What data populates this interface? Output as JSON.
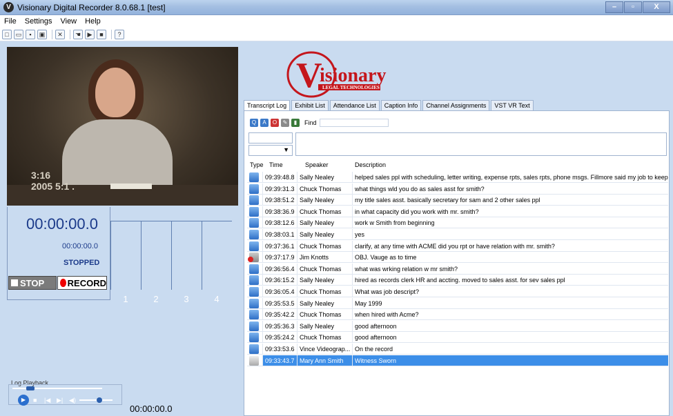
{
  "window": {
    "title": "Visionary Digital Recorder 8.0.68.1 [test]",
    "app_icon": "V"
  },
  "window_controls": [
    "–",
    "▫",
    "X"
  ],
  "menu": [
    "File",
    "Settings",
    "View",
    "Help"
  ],
  "toolbar_icons": [
    "new-file-icon",
    "open-file-icon",
    "save-icon",
    "save-as-icon",
    "tools-icon",
    "hand-icon",
    "camera-icon",
    "monitor-icon",
    "help-icon"
  ],
  "video": {
    "timestamp_line1": "3:16",
    "timestamp_line2": "2005 5:1 ."
  },
  "recorder": {
    "big_time": "00:00:00.0",
    "small_time": "00:00:00.0",
    "status": "STOPPED",
    "stop_label": "STOP",
    "record_label": "RECORD",
    "channels": [
      "1",
      "2",
      "3",
      "4"
    ]
  },
  "playback": {
    "label": "Log Playback",
    "time": "00:00:00.0",
    "position": 0.15,
    "volume": 0.5
  },
  "logo": {
    "name": "isionary",
    "initial": "V",
    "subtitle": "LEGAL TECHNOLOGIES",
    "color": "#c4161c"
  },
  "tabs": [
    "Transcript Log",
    "Exhibit List",
    "Attendance List",
    "Caption Info",
    "Channel Assignments",
    "VST VR Text"
  ],
  "active_tab": "Transcript Log",
  "log_toolbar": {
    "find_label": "Find"
  },
  "columns": [
    "Type",
    "Time",
    "Speaker",
    "Description"
  ],
  "rows": [
    {
      "type": "A",
      "time": "09:39:48.8",
      "speaker": "Sally Nealey",
      "desc": "helped sales ppl with scheduling, letter writing, expense rpts, sales rpts, phone msgs.  Fillmore said my job to keep them selling"
    },
    {
      "type": "Q",
      "time": "09:39:31.3",
      "speaker": "Chuck Thomas",
      "desc": "what things wld you do as sales asst for smith?"
    },
    {
      "type": "A",
      "time": "09:38:51.2",
      "speaker": "Sally Nealey",
      "desc": "my title sales asst.  basically secretary for sam and 2 other sales ppl"
    },
    {
      "type": "Q",
      "time": "09:38:36.9",
      "speaker": "Chuck Thomas",
      "desc": "in what capacity did you work with mr. smith?"
    },
    {
      "type": "A",
      "time": "09:38:12.6",
      "speaker": "Sally Nealey",
      "desc": "work w Smith from beginning"
    },
    {
      "type": "A",
      "time": "09:38:03.1",
      "speaker": "Sally Nealey",
      "desc": "yes"
    },
    {
      "type": "Q",
      "time": "09:37:36.1",
      "speaker": "Chuck Thomas",
      "desc": "clarify, at any time with ACME did you rpt or have relation with mr. smith?"
    },
    {
      "type": "OBJ",
      "time": "09:37:17.9",
      "speaker": "Jim Knotts",
      "desc": "OBJ.  Vauge as to time"
    },
    {
      "type": "Q",
      "time": "09:36:56.4",
      "speaker": "Chuck Thomas",
      "desc": "what was wrking relation w mr smith?"
    },
    {
      "type": "A",
      "time": "09:36:15.2",
      "speaker": "Sally Nealey",
      "desc": "hired as records clerk HR and accting.  moved to sales asst. for sev sales ppl"
    },
    {
      "type": "Q",
      "time": "09:36:05.4",
      "speaker": "Chuck Thomas",
      "desc": "What was job descript?"
    },
    {
      "type": "A",
      "time": "09:35:53.5",
      "speaker": "Sally Nealey",
      "desc": "May 1999"
    },
    {
      "type": "Q",
      "time": "09:35:42.2",
      "speaker": "Chuck Thomas",
      "desc": "when hired with Acme?"
    },
    {
      "type": "A",
      "time": "09:35:36.3",
      "speaker": "Sally Nealey",
      "desc": "good afternoon"
    },
    {
      "type": "Q",
      "time": "09:35:24.2",
      "speaker": "Chuck Thomas",
      "desc": "good afternoon"
    },
    {
      "type": "A",
      "time": "09:33:53.6",
      "speaker": "Vince Videograp...",
      "desc": "On the record"
    },
    {
      "type": "SWORN",
      "time": "09:33:43.7",
      "speaker": "Mary Ann Smith",
      "desc": "Witness Sworn",
      "selected": true
    }
  ]
}
